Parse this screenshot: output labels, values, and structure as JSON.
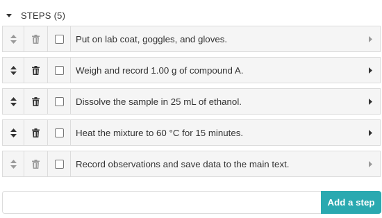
{
  "header": {
    "label": "STEPS",
    "count": "(5)"
  },
  "steps": [
    {
      "text": "Put on lab coat, goggles, and gloves.",
      "checked": false,
      "icon_shade": "light"
    },
    {
      "text": "Weigh and record 1.00 g of compound A.",
      "checked": false,
      "icon_shade": "dark"
    },
    {
      "text": "Dissolve the sample in 25 mL of ethanol.",
      "checked": false,
      "icon_shade": "dark"
    },
    {
      "text": "Heat the mixture to 60 °C for 15 minutes.",
      "checked": false,
      "icon_shade": "dark"
    },
    {
      "text": "Record observations and save data to the main text.",
      "checked": false,
      "icon_shade": "light"
    }
  ],
  "add_step": {
    "input_value": "",
    "input_placeholder": "",
    "button_label": "Add a step"
  },
  "colors": {
    "accent": "#2aa9b0",
    "row_background": "#f5f5f5",
    "border": "#dcdcdc"
  },
  "icons": {
    "collapse": "caret-down-icon",
    "drag": "sort-icon",
    "delete": "trash-icon",
    "expand": "caret-right-icon"
  }
}
